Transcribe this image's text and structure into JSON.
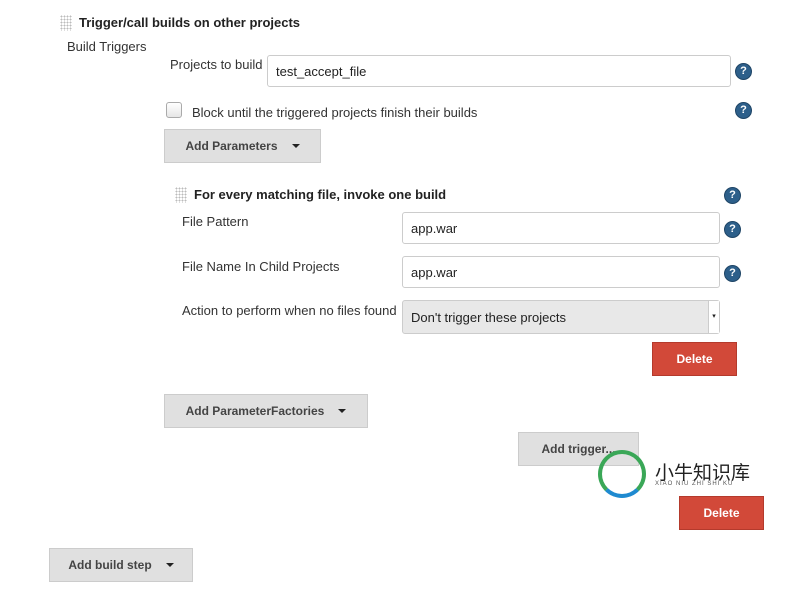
{
  "trigger": {
    "title": "Trigger/call builds on other projects",
    "section_label": "Build Triggers",
    "projects_label": "Projects to build",
    "projects_value": "test_accept_file",
    "block_label": "Block until the triggered projects finish their builds",
    "block_checked": false,
    "add_parameters": "Add Parameters"
  },
  "file_factory": {
    "title": "For every matching file, invoke one build",
    "file_pattern_label": "File Pattern",
    "file_pattern_value": "app.war",
    "child_name_label": "File Name In Child Projects",
    "child_name_value": "app.war",
    "action_label": "Action to perform when no files found",
    "action_value": "Don't trigger these projects",
    "delete": "Delete"
  },
  "add_parameter_factories": "Add ParameterFactories",
  "add_trigger": "Add trigger...",
  "delete": "Delete",
  "add_build_step": "Add build step",
  "watermark": {
    "cn": "小牛知识库",
    "pinyin": "XIAO NIU ZHI SHI KU"
  },
  "colors": {
    "delete": "#d24939",
    "help": "#2d5f8a",
    "button": "#e0e0e0"
  }
}
